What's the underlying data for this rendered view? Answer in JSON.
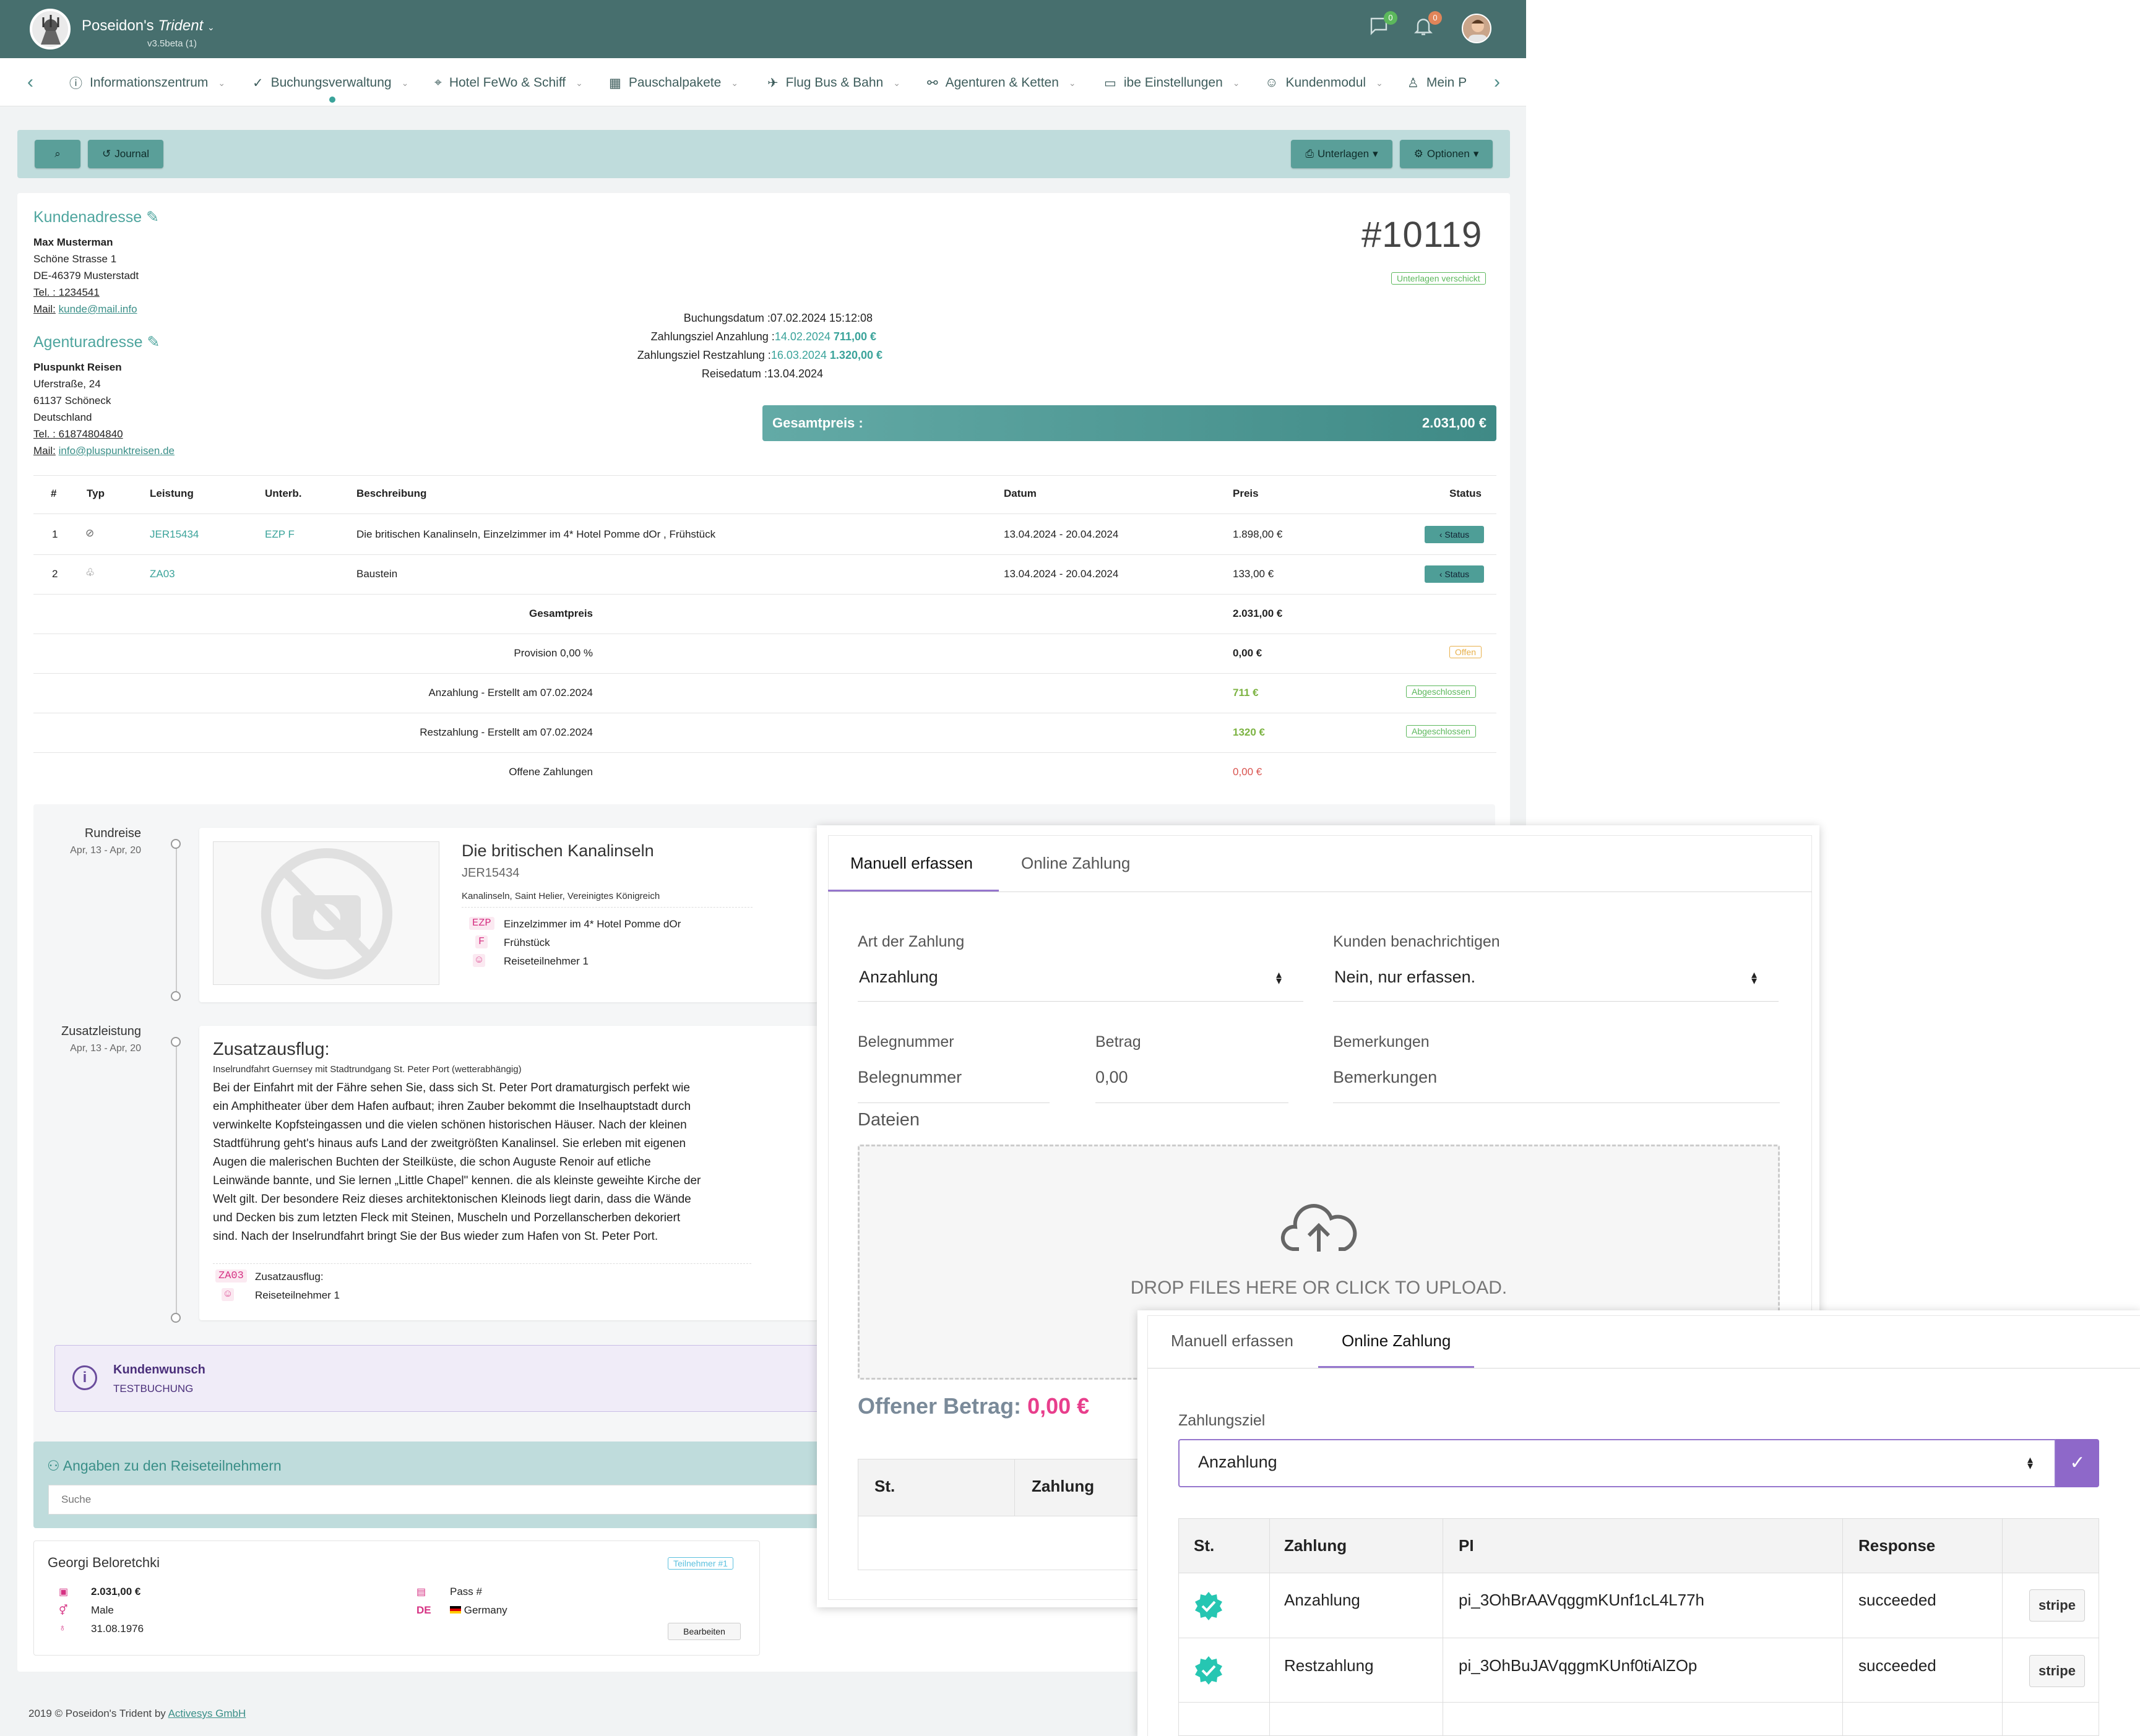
{
  "app": {
    "title_prefix": "Poseidon's",
    "title_italic": "Trident",
    "version": "v3.5beta (1)",
    "msg_count": "0",
    "notif_count": "0"
  },
  "nav": {
    "items": [
      "Informationszentrum",
      "Buchungsverwaltung",
      "Hotel FeWo & Schiff",
      "Pauschalpakete",
      "Flug Bus & Bahn",
      "Agenturen & Ketten",
      "ibe Einstellungen",
      "Kundenmodul",
      "Mein P"
    ]
  },
  "toolbar": {
    "journal": "Journal",
    "unterlagen": "Unterlagen",
    "optionen": "Optionen"
  },
  "customer": {
    "heading": "Kundenadresse",
    "name": "Max Musterman",
    "street": "Schöne Strasse 1",
    "city": "DE-46379 Musterstadt",
    "tel_label": "Tel. : 1234541",
    "mail_label": "Mail:",
    "mail": "kunde@mail.info"
  },
  "agency": {
    "heading": "Agenturadresse",
    "name": "Pluspunkt Reisen",
    "street": "Uferstraße, 24",
    "city": "61137 Schöneck",
    "country": "Deutschland",
    "tel_label": "Tel. : 61874804840",
    "mail_label": "Mail:",
    "mail": "info@pluspunktreisen.de"
  },
  "booking": {
    "number": "#10119",
    "status_tag": "Unterlagen verschickt",
    "rows": [
      {
        "label": "Buchungsdatum :",
        "value": "07.02.2024 15:12:08",
        "extra": ""
      },
      {
        "label": "Zahlungsziel Anzahlung :",
        "value": "14.02.2024",
        "extra": "711,00 €"
      },
      {
        "label": "Zahlungsziel Restzahlung :",
        "value": "16.03.2024",
        "extra": "1.320,00 €"
      },
      {
        "label": "Reisedatum :",
        "value": "13.04.2024",
        "extra": ""
      }
    ],
    "total_label": "Gesamtpreis :",
    "total_value": "2.031,00 €"
  },
  "table": {
    "headers": [
      "#",
      "Typ",
      "Leistung",
      "Unterb.",
      "Beschreibung",
      "Datum",
      "Preis",
      "Status"
    ],
    "rows": [
      {
        "no": "1",
        "code": "JER15434",
        "unterb": "EZP F",
        "desc": "Die britischen Kanalinseln, Einzelzimmer im 4* Hotel Pomme dOr , Frühstück",
        "date": "13.04.2024 - 20.04.2024",
        "price": "1.898,00 €",
        "status": "‹ Status"
      },
      {
        "no": "2",
        "code": "ZA03",
        "unterb": "",
        "desc": "Baustein",
        "date": "13.04.2024 - 20.04.2024",
        "price": "133,00 €",
        "status": "‹ Status"
      }
    ],
    "summary": [
      {
        "label": "Gesamtpreis",
        "value": "2.031,00 €",
        "tag": ""
      },
      {
        "label": "Provision 0,00 %",
        "value": "0,00 €",
        "tag": "Offen"
      },
      {
        "label": "Anzahlung - Erstellt am 07.02.2024",
        "value": "711 €",
        "tag": "Abgeschlossen"
      },
      {
        "label": "Restzahlung - Erstellt am 07.02.2024",
        "value": "1320 €",
        "tag": "Abgeschlossen"
      },
      {
        "label": "Offene Zahlungen",
        "value": "0,00 €",
        "tag": ""
      }
    ]
  },
  "timeline": {
    "trip": {
      "label": "Rundreise",
      "dates": "Apr, 13 - Apr, 20",
      "title": "Die britischen Kanalinseln",
      "code": "JER15434",
      "location": "Kanalinseln, Saint Helier, Vereinigtes Königreich",
      "items": [
        {
          "abbr": "EZP",
          "text": "Einzelzimmer im 4* Hotel Pomme dOr"
        },
        {
          "abbr": "F",
          "text": "Frühstück"
        },
        {
          "abbr": "☺",
          "text": "Reiseteilnehmer 1"
        }
      ]
    },
    "extra": {
      "label": "Zusatzleistung",
      "dates": "Apr, 13 - Apr, 20",
      "title": "Zusatzausflug:",
      "subtitle": "Inselrundfahrt Guernsey mit Stadtrundgang St. Peter Port (wetterabhängig)",
      "lines": [
        "Bei der Einfahrt mit der Fähre sehen Sie, dass sich St. Peter Port dramaturgisch perfekt wie",
        "ein Amphitheater über dem Hafen aufbaut; ihren Zauber bekommt die Inselhauptstadt durch",
        "verwinkelte Kopfsteingassen und die vielen schönen historischen Häuser. Nach der kleinen",
        "Stadtführung geht's hinaus aufs Land der zweitgrößten Kanalinsel. Sie erleben mit eigenen",
        "Augen die malerischen Buchten der Steilküste, die schon Auguste Renoir auf etliche",
        "Leinwände bannte, und Sie lernen „Little Chapel\" kennen. die als kleinste geweihte Kirche der",
        "Welt gilt. Der besondere Reiz dieses architektonischen Kleinods liegt darin, dass die Wände",
        "und Decken bis zum letzten Fleck mit Steinen, Muscheln und Porzellanscherben dekoriert",
        "sind. Nach der Inselrundfahrt bringt Sie der Bus wieder zum Hafen von St. Peter Port."
      ],
      "items": [
        {
          "abbr": "ZA03",
          "text": "Zusatzausflug:"
        },
        {
          "abbr": "☺",
          "text": "Reiseteilnehmer 1"
        }
      ]
    }
  },
  "wish": {
    "title": "Kundenwunsch",
    "text": "TESTBUCHUNG"
  },
  "participants": {
    "heading": "Angaben zu den Reiseteilnehmern",
    "search_placeholder": "Suche",
    "name": "Georgi Beloretchki",
    "tag": "Teilnehmer #1",
    "price": "2.031,00 €",
    "gender": "Male",
    "birth": "31.08.1976",
    "pass": "Pass #",
    "country_code": "DE",
    "country": "Germany",
    "edit": "Bearbeiten"
  },
  "footer": {
    "text": "2019 © Poseidon's Trident by",
    "link": "Activesys GmbH"
  },
  "payment": {
    "tab_manual": "Manuell erfassen",
    "tab_online": "Online Zahlung",
    "type_label": "Art der Zahlung",
    "type_value": "Anzahlung",
    "notify_label": "Kunden benachrichtigen",
    "notify_value": "Nein, nur erfassen.",
    "receipt_label": "Belegnummer",
    "receipt_placeholder": "Belegnummer",
    "amount_label": "Betrag",
    "amount_value": "0,00",
    "notes_label": "Bemerkungen",
    "notes_placeholder": "Bemerkungen",
    "files_label": "Dateien",
    "drop_text": "DROP FILES HERE OR CLICK TO UPLOAD.",
    "open_label": "Offener Betrag:",
    "open_value": "0,00 €",
    "col_st": "St.",
    "col_payment": "Zahlung"
  },
  "online": {
    "target_label": "Zahlungsziel",
    "target_value": "Anzahlung",
    "headers": [
      "St.",
      "Zahlung",
      "PI",
      "Response"
    ],
    "rows": [
      {
        "payment": "Anzahlung",
        "pi": "pi_3OhBrAAVqggmKUnf1cL4L77h",
        "response": "succeeded",
        "btn": "stripe"
      },
      {
        "payment": "Restzahlung",
        "pi": "pi_3OhBuJAVqggmKUnf0tiAlZOp",
        "response": "succeeded",
        "btn": "stripe"
      }
    ]
  },
  "colors": {
    "header": "#476f6e",
    "accent": "#3aa39a",
    "pink": "#e83e8c",
    "purple": "#7e57c2"
  }
}
